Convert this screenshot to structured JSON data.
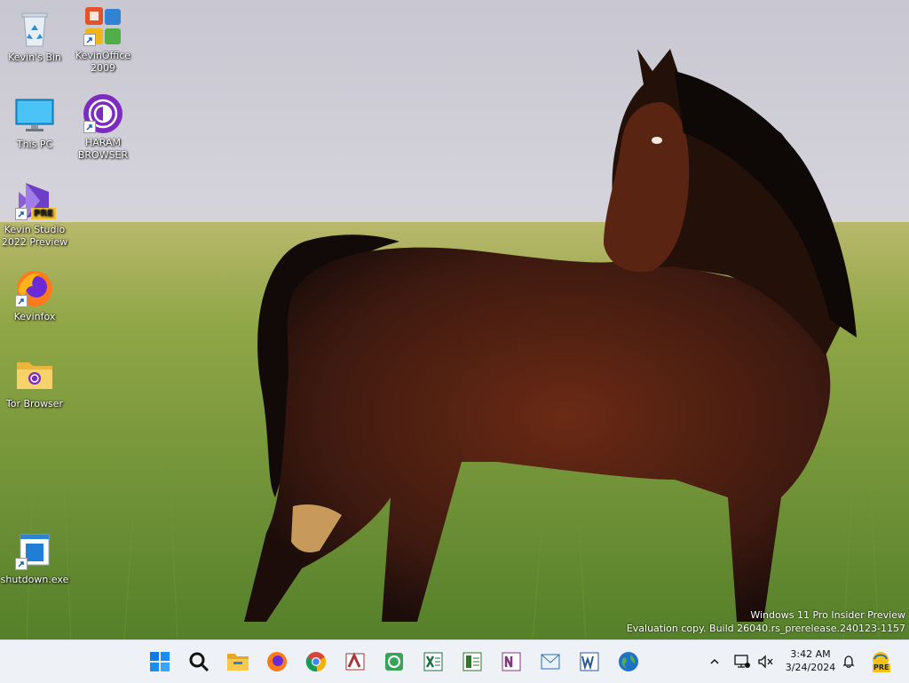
{
  "desktop": {
    "icons": [
      {
        "id": "recycle",
        "label": "Kevin's Bin",
        "icon": "recycle-bin-icon"
      },
      {
        "id": "office",
        "label": "KevinOffice 2009",
        "icon": "office-icon"
      },
      {
        "id": "thispc",
        "label": "This PC",
        "icon": "monitor-icon"
      },
      {
        "id": "haram",
        "label": "HARAM BROWSER",
        "icon": "tor-onion-icon"
      },
      {
        "id": "studio",
        "label": "Kevin Studio 2022 Preview",
        "icon": "visual-studio-icon",
        "badge": "PRE"
      },
      {
        "id": "kevinfox",
        "label": "Kevinfox",
        "icon": "firefox-icon"
      },
      {
        "id": "tor",
        "label": "Tor Browser",
        "icon": "folder-icon"
      },
      {
        "id": "shutdown",
        "label": "shutdown.exe",
        "icon": "document-icon"
      }
    ]
  },
  "watermark": {
    "line1": "Windows 11 Pro Insider Preview",
    "line2": "Evaluation copy. Build 26040.rs_prerelease.240123-1157"
  },
  "taskbar": {
    "apps": [
      "start-icon",
      "search-icon",
      "file-explorer-icon",
      "firefox-icon",
      "chrome-icon",
      "access-icon",
      "publisher-icon",
      "excel-icon",
      "project-icon",
      "onenote-icon",
      "outlook-icon",
      "word-icon",
      "globe-icon"
    ],
    "tray_icons": [
      "chevron-up-icon",
      "network-icon",
      "volume-muted-icon"
    ],
    "clock": {
      "time": "3:42 AM",
      "date": "3/24/2024"
    },
    "badge": "PRE",
    "colors": {
      "accent": "#0067c0",
      "taskbar_bg": "#eef1f5"
    }
  }
}
